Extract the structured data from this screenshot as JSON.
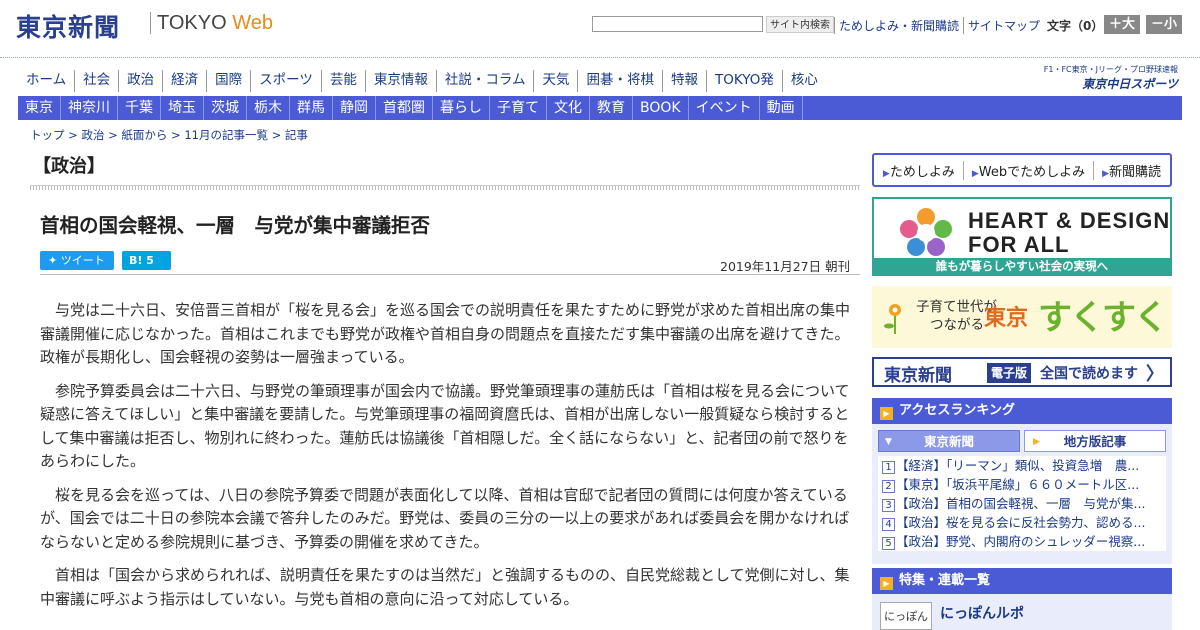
{
  "header": {
    "logo": "東京新聞",
    "tokyo_web_a": "TOKYO",
    "tokyo_web_b": "Web",
    "search_placeholder": "",
    "search_button": "サイト内検索",
    "links": [
      "ためしよみ・新聞購読",
      "サイトマップ"
    ],
    "font_size_label": "文字（0）",
    "font_bigger": "＋大",
    "font_smaller": "－小"
  },
  "nav_main": [
    "ホーム",
    "社会",
    "政治",
    "経済",
    "国際",
    "スポーツ",
    "芸能",
    "東京情報",
    "社説・コラム",
    "天気",
    "囲碁・将棋",
    "特報",
    "TOKYO発",
    "核心"
  ],
  "chunichi": {
    "line1": "F1・FC東京・Jリーグ・プロ野球速報",
    "line2": "東京中日スポーツ"
  },
  "nav_region": [
    "東京",
    "神奈川",
    "千葉",
    "埼玉",
    "茨城",
    "栃木",
    "群馬",
    "静岡",
    "首都圏",
    "暮らし",
    "子育て",
    "文化",
    "教育",
    "BOOK",
    "イベント",
    "動画"
  ],
  "breadcrumb": "トップ > 政治 > 紙面から > 11月の記事一覧 > 記事",
  "section_title": "【政治】",
  "article": {
    "headline": "首相の国会軽視、一層　与党が集中審議拒否",
    "tweet_label": "ツイート",
    "hatena_label": "B! 5",
    "date": "2019年11月27日 朝刊",
    "paragraphs": [
      "与党は二十六日、安倍晋三首相が「桜を見る会」を巡る国会での説明責任を果たすために野党が求めた首相出席の集中審議開催に応じなかった。首相はこれまでも野党が政権や首相自身の問題点を直接ただす集中審議の出席を避けてきた。政権が長期化し、国会軽視の姿勢は一層強まっている。",
      "参院予算委員会は二十六日、与野党の筆頭理事が国会内で協議。野党筆頭理事の蓮舫氏は「首相は桜を見る会について疑惑に答えてほしい」と集中審議を要請した。与党筆頭理事の福岡資麿氏は、首相が出席しない一般質疑なら検討するとして集中審議は拒否し、物別れに終わった。蓮舫氏は協議後「首相隠しだ。全く話にならない」と、記者団の前で怒りをあらわにした。",
      "桜を見る会を巡っては、八日の参院予算委で問題が表面化して以降、首相は官邸で記者団の質問には何度か答えているが、国会では二十日の参院本会議で答弁したのみだ。野党は、委員の三分の一以上の要求があれば委員会を開かなければならないと定める参院規則に基づき、予算委の開催を求めてきた。",
      "首相は「国会から求められれば、説明責任を果たすのは当然だ」と強調するものの、自民党総裁として党側に対し、集中審議に呼ぶよう指示はしていない。与党も首相の意向に沿って対応している。"
    ]
  },
  "sidebar": {
    "buttons": [
      "ためしよみ",
      "Webでためしよみ",
      "新聞購読"
    ],
    "heart_line1": "HEART & DESIGN",
    "heart_line2": "FOR ALL",
    "heart_caption": "誰もが暮らしやすい社会の実現へ",
    "suku_line1": "子育て世代が",
    "suku_line2": "つながる",
    "suku_tokyo": "東京",
    "suku_brand": "すくすく",
    "denshi_logo": "東京新聞",
    "denshi_badge": "電子版",
    "denshi_text": "全国で読めます",
    "denshi_arrow": "〉",
    "ranking_title": "アクセスランキング",
    "ranking_tabs": [
      "東京新聞",
      "地方版記事"
    ],
    "ranking": [
      {
        "n": "1",
        "text": "【経済】「リーマン」類似、投資急増　農..."
      },
      {
        "n": "2",
        "text": "【東京】「坂浜平尾線」６６０メートル区..."
      },
      {
        "n": "3",
        "text": "【政治】首相の国会軽視、一層　与党が集..."
      },
      {
        "n": "4",
        "text": "【政治】桜を見る会に反社会勢力、認める..."
      },
      {
        "n": "5",
        "text": "【政治】野党、内閣府のシュレッダー視察..."
      }
    ],
    "feature_title": "特集・連載一覧",
    "feature_logo": "にっぽん",
    "feature_item": "にっぽんルポ"
  }
}
